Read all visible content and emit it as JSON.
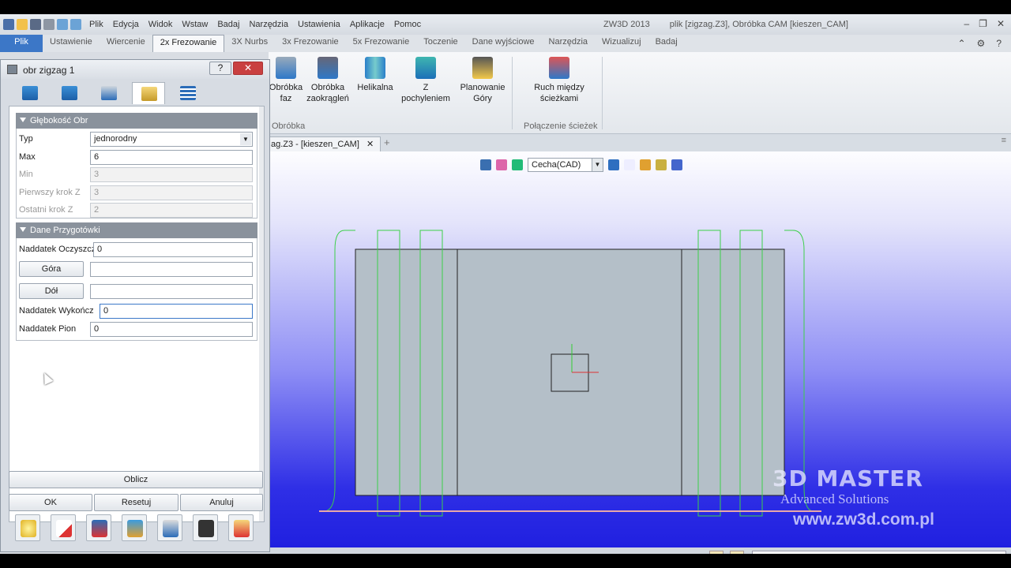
{
  "app": {
    "window_title": "ZW3D 2013",
    "file_title": "plik [zigzag.Z3], Obróbka CAM [kieszen_CAM]",
    "menu": [
      "Plik",
      "Edycja",
      "Widok",
      "Wstaw",
      "Badaj",
      "Narzędzia",
      "Ustawienia",
      "Aplikacje",
      "Pomoc"
    ]
  },
  "ribbon_tabs": [
    "Plik",
    "Ustawienie",
    "Wiercenie",
    "2x Frezowanie",
    "3X Nurbs",
    "3x Frezowanie",
    "5x Frezowanie",
    "Toczenie",
    "Dane wyjściowe",
    "Narzędzia",
    "Wizualizuj",
    "Badaj"
  ],
  "active_ribbon_tab": "2x Frezowanie",
  "ribbon": {
    "buttons": [
      {
        "label": "Obróbka faz",
        "icon": "chamfer-tool-icon"
      },
      {
        "label": "Obróbka zaokrągleń",
        "icon": "fillet-tool-icon"
      },
      {
        "label": "Helikalna",
        "icon": "helical-icon"
      },
      {
        "label": "Z pochyleniem",
        "icon": "slope-icon"
      },
      {
        "label": "Planowanie Góry",
        "icon": "face-milling-icon"
      },
      {
        "label": "Ruch między ścieżkami",
        "icon": "link-moves-icon"
      }
    ],
    "group_obrobka": "Obróbka",
    "group_polaczenie": "Połączenie ścieżek"
  },
  "doc_tab": {
    "label": "ag.Z3 - [kieszen_CAM]"
  },
  "view_toolbar": {
    "display_combo": "Cecha(CAD)"
  },
  "watermark": {
    "brand": "3D MASTER",
    "tagline": "Advanced Solutions",
    "url": "www.zw3d.com.pl"
  },
  "panel": {
    "title": "obr zigzag 1",
    "section_depth": "Głębokość Obr",
    "depth_fields": [
      {
        "label": "Typ",
        "value": "jednorodny",
        "enabled": true
      },
      {
        "label": "Max",
        "value": "6",
        "enabled": true
      },
      {
        "label": "Min",
        "value": "3",
        "enabled": false
      },
      {
        "label": "Pierwszy krok Z",
        "value": "3",
        "enabled": false
      },
      {
        "label": "Ostatni krok Z",
        "value": "2",
        "enabled": false
      }
    ],
    "section_stock": "Dane Przygotówki",
    "stock_fields": {
      "clean_allowance_label": "Naddatek Oczyszcz",
      "clean_allowance_value": "0",
      "top_button": "Góra",
      "bottom_button": "Dół",
      "finish_allowance_label": "Naddatek Wykończ",
      "finish_allowance_value": "0",
      "vertical_allowance_label": "Naddatek Pion",
      "vertical_allowance_value": "0"
    },
    "compute_button": "Oblicz",
    "ok_button": "OK",
    "reset_button": "Resetuj",
    "cancel_button": "Anuluj"
  }
}
